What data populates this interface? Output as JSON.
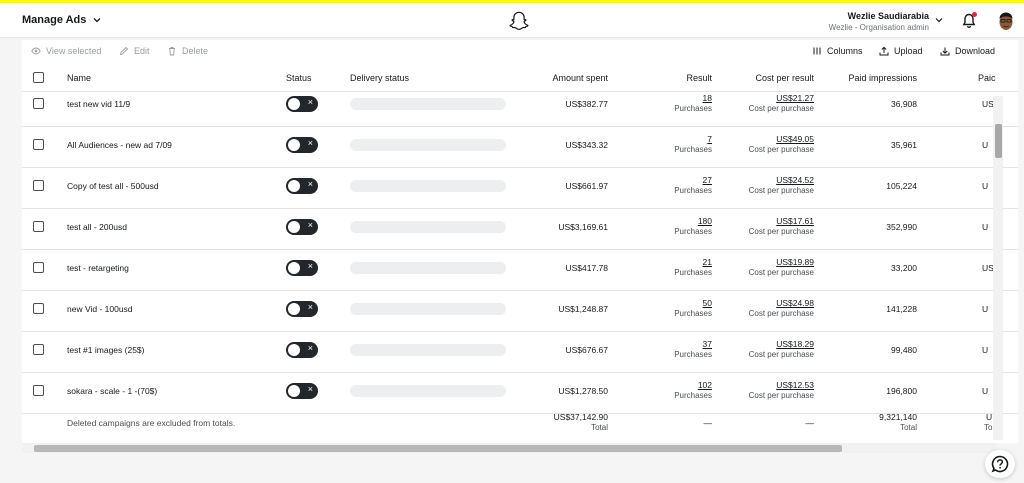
{
  "header": {
    "title": "Manage Ads",
    "user_name": "Wezlie Saudiarabia",
    "user_role": "Wezlie - Organisation admin"
  },
  "toolbar": {
    "view_selected": "View selected",
    "edit": "Edit",
    "delete": "Delete",
    "columns": "Columns",
    "upload": "Upload",
    "download": "Download"
  },
  "columns": {
    "name": "Name",
    "status": "Status",
    "delivery_status": "Delivery status",
    "amount_spent": "Amount spent",
    "result": "Result",
    "cost_per_result": "Cost per result",
    "paid_impressions": "Paid impressions",
    "next": "Paic"
  },
  "rows": [
    {
      "name": "test new vid 11/9",
      "amount": "US$382.77",
      "result": "18",
      "result_label": "Purchases",
      "cpr": "US$21.27",
      "cpr_label": "Cost per purchase",
      "impressions": "36,908",
      "next": "US"
    },
    {
      "name": "All Audiences - new ad 7/09",
      "amount": "US$343.32",
      "result": "7",
      "result_label": "Purchases",
      "cpr": "US$49.05",
      "cpr_label": "Cost per purchase",
      "impressions": "35,961",
      "next": "U"
    },
    {
      "name": "Copy of test all - 500usd",
      "amount": "US$661.97",
      "result": "27",
      "result_label": "Purchases",
      "cpr": "US$24.52",
      "cpr_label": "Cost per purchase",
      "impressions": "105,224",
      "next": "U"
    },
    {
      "name": "test all - 200usd",
      "amount": "US$3,169.61",
      "result": "180",
      "result_label": "Purchases",
      "cpr": "US$17.61",
      "cpr_label": "Cost per purchase",
      "impressions": "352,990",
      "next": "U"
    },
    {
      "name": "test - retargeting",
      "amount": "US$417.78",
      "result": "21",
      "result_label": "Purchases",
      "cpr": "US$19.89",
      "cpr_label": "Cost per purchase",
      "impressions": "33,200",
      "next": "US"
    },
    {
      "name": "new Vid - 100usd",
      "amount": "US$1,248.87",
      "result": "50",
      "result_label": "Purchases",
      "cpr": "US$24.98",
      "cpr_label": "Cost per purchase",
      "impressions": "141,228",
      "next": "U"
    },
    {
      "name": "test #1 images (25$)",
      "amount": "US$676.67",
      "result": "37",
      "result_label": "Purchases",
      "cpr": "US$18.29",
      "cpr_label": "Cost per purchase",
      "impressions": "99,480",
      "next": "U"
    },
    {
      "name": "sokara - scale - 1 -(70$)",
      "amount": "US$1,278.50",
      "result": "102",
      "result_label": "Purchases",
      "cpr": "US$12.53",
      "cpr_label": "Cost per purchase",
      "impressions": "196,800",
      "next": "U"
    }
  ],
  "totals": {
    "note": "Deleted campaigns are excluded from totals.",
    "amount": "US$37,142.90",
    "amount_label": "Total",
    "result": "—",
    "cpr": "—",
    "impressions": "9,321,140",
    "impressions_label": "Total",
    "next": "U",
    "next_label": "To"
  },
  "icons": {
    "view": "eye-icon",
    "edit": "pencil-icon",
    "delete": "trash-icon",
    "columns": "columns-icon",
    "upload": "upload-icon",
    "download": "download-icon",
    "bell": "bell-icon",
    "help": "help-icon"
  },
  "colors": {
    "accent": "#fffc00",
    "toggle_off": "#23262a",
    "notification": "#e8253d"
  }
}
